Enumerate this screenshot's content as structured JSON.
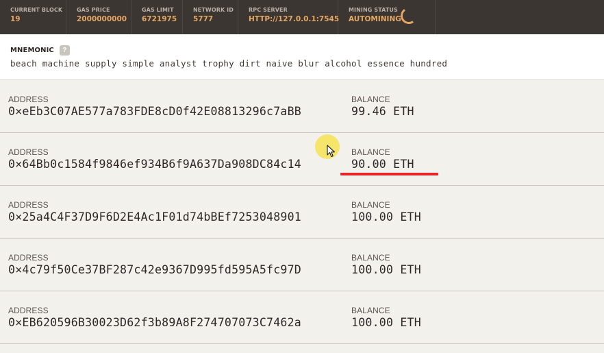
{
  "topbar": {
    "current_block": {
      "label": "CURRENT BLOCK",
      "value": "19"
    },
    "gas_price": {
      "label": "GAS PRICE",
      "value": "2000000000"
    },
    "gas_limit": {
      "label": "GAS LIMIT",
      "value": "6721975"
    },
    "network_id": {
      "label": "NETWORK ID",
      "value": "5777"
    },
    "rpc_server": {
      "label": "RPC SERVER",
      "value": "HTTP://127.0.0.1:7545"
    },
    "mining_status": {
      "label": "MINING STATUS",
      "value": "AUTOMINING"
    },
    "accent_color": "#e4a663",
    "spinner_icon": "loading-spinner-icon"
  },
  "mnemonic": {
    "label": "MNEMONIC",
    "help_icon_text": "?",
    "words": "beach machine supply simple analyst trophy dirt naive blur alcohol essence hundred"
  },
  "accounts": [
    {
      "address_label": "ADDRESS",
      "address": "0×eEb3C07AE577a783FDE8cD0f42E08813296c7aBB",
      "balance_label": "BALANCE",
      "balance": "99.46 ETH"
    },
    {
      "address_label": "ADDRESS",
      "address": "0×64Bb0c1584f9846ef934B6f9A637Da908DC84c14",
      "balance_label": "BALANCE",
      "balance": "90.00 ETH"
    },
    {
      "address_label": "ADDRESS",
      "address": "0×25a4C4F37D9F6D2E4Ac1F01d74bBEf7253048901",
      "balance_label": "BALANCE",
      "balance": "100.00 ETH"
    },
    {
      "address_label": "ADDRESS",
      "address": "0×4c79f50Ce37BF287c42e9367D995fd595A5fc97D",
      "balance_label": "BALANCE",
      "balance": "100.00 ETH"
    },
    {
      "address_label": "ADDRESS",
      "address": "0×EB620596B30023D62f3b89A8F274707073C7462a",
      "balance_label": "BALANCE",
      "balance": "100.00 ETH"
    }
  ],
  "annotations": {
    "underline_color": "#e5262b",
    "cursor_highlight_color": "#f6e246"
  }
}
